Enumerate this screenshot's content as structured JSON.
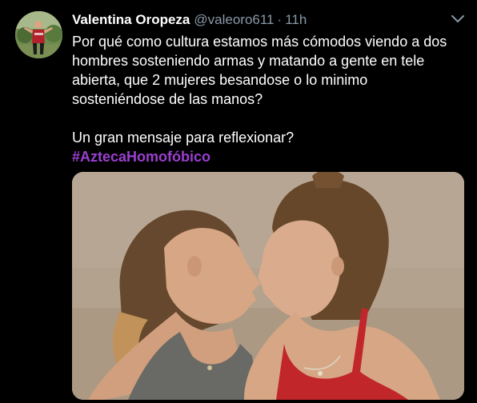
{
  "tweet": {
    "author": {
      "display_name": "Valentina Oropeza",
      "handle": "@valeoro611",
      "separator": "·",
      "time": "11h",
      "avatar_icon": "user-avatar"
    },
    "text_lines": [
      "Por qué como cultura estamos más cómodos viendo a dos",
      "hombres sosteniendo armas y matando a gente en tele",
      "abierta, que 2 mujeres besandose o lo minimo",
      "sosteniéndose de las manos?"
    ],
    "text_line_2": "Un gran mensaje para reflexionar?",
    "hashtag": "#AztecaHomofóbico",
    "caret_icon": "chevron-down-icon",
    "media_alt": "photo"
  },
  "colors": {
    "background": "#000000",
    "text": "#ffffff",
    "secondary_text": "#8899a6",
    "hashtag": "#9b3fd1"
  }
}
